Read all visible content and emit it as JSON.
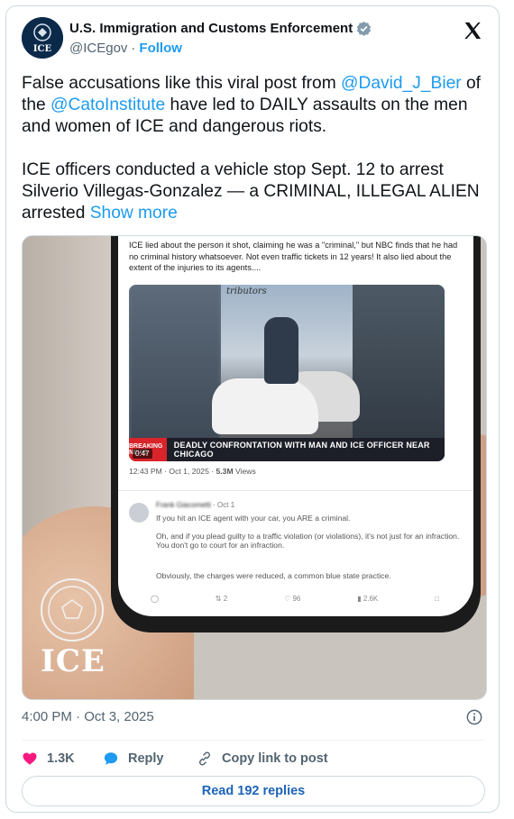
{
  "author": {
    "name": "U.S. Immigration and Customs Enforcement",
    "handle": "@ICEgov",
    "separator": "·",
    "follow_label": "Follow",
    "avatar_text": "ICE"
  },
  "tweet": {
    "p1_pre": "False accusations like this viral post from ",
    "mention1": "@David_J_Bier",
    "p1_mid": " of the ",
    "mention2": "@CatoInstitute",
    "p1_post": " have led to DAILY assaults on the men and women of ICE and dangerous riots.",
    "p2": "ICE officers conducted a vehicle stop Sept. 12 to arrest Silverio Villegas-Gonzalez — a CRIMINAL, ILLEGAL ALIEN arrested ",
    "show_more": "Show more"
  },
  "media": {
    "screen_text": "ICE lied about the person it shot, claiming he was a \"criminal,\" but NBC finds that he had no criminal history whatsoever. Not even traffic tickets in 12 years! It also lied about the extent of the injuries to its agents....",
    "video_sign": "tributors",
    "breaking_label": "BREAKING NEWS",
    "banner_text": "DEADLY CONFRONTATION WITH MAN AND ICE OFFICER NEAR CHICAGO",
    "duration": "0:47",
    "screen_time": "12:43 PM · Oct 1, 2025 · ",
    "screen_views": "5.3M",
    "screen_views_label": " Views",
    "reply_name": "Frank Giacometti",
    "reply_date": "· Oct 1",
    "reply_line1": "If you hit an ICE agent with your car, you ARE a criminal.",
    "reply_line2": "Oh, and if you plead guilty to a traffic violation (or violations), it's not just for an infraction. You don't go to court for an infraction.",
    "reply_line3": "Obviously, the charges were reduced, a common blue state practice.",
    "reply_retweets": "2",
    "reply_likes": "96",
    "reply_views": "2.6K",
    "watermark": "ICE"
  },
  "meta": {
    "timestamp": "4:00 PM · Oct 3, 2025"
  },
  "actions": {
    "likes": "1.3K",
    "reply_label": "Reply",
    "copy_label": "Copy link to post",
    "read_replies": "Read 192 replies"
  },
  "colors": {
    "accent": "#1d9bf0",
    "heart": "#f91880",
    "text": "#0f1419",
    "muted": "#536471"
  }
}
